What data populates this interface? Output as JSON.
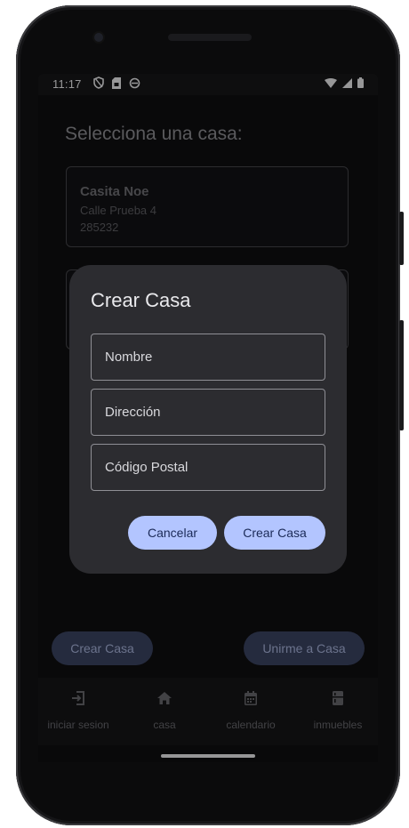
{
  "status_bar": {
    "time": "11:17"
  },
  "main": {
    "title": "Selecciona una casa:",
    "houses": [
      {
        "name": "Casita Noe",
        "address": "Calle Prueba 4",
        "postal_code": "285232"
      }
    ]
  },
  "actions": {
    "create_label": "Crear Casa",
    "join_label": "Unirme a Casa"
  },
  "nav": {
    "items": [
      {
        "label": "iniciar sesion",
        "icon": "login-icon"
      },
      {
        "label": "casa",
        "icon": "home-icon"
      },
      {
        "label": "calendario",
        "icon": "calendar-icon"
      },
      {
        "label": "inmuebles",
        "icon": "fridge-icon"
      }
    ]
  },
  "dialog": {
    "title": "Crear Casa",
    "fields": [
      {
        "placeholder": "Nombre",
        "value": ""
      },
      {
        "placeholder": "Dirección",
        "value": ""
      },
      {
        "placeholder": "Código Postal",
        "value": ""
      }
    ],
    "cancel_label": "Cancelar",
    "confirm_label": "Crear Casa"
  },
  "colors": {
    "accent": "#b3c5ff",
    "accent_muted": "#3a4260",
    "dialog_bg": "#2c2c30",
    "screen_bg": "#0e0e10"
  }
}
